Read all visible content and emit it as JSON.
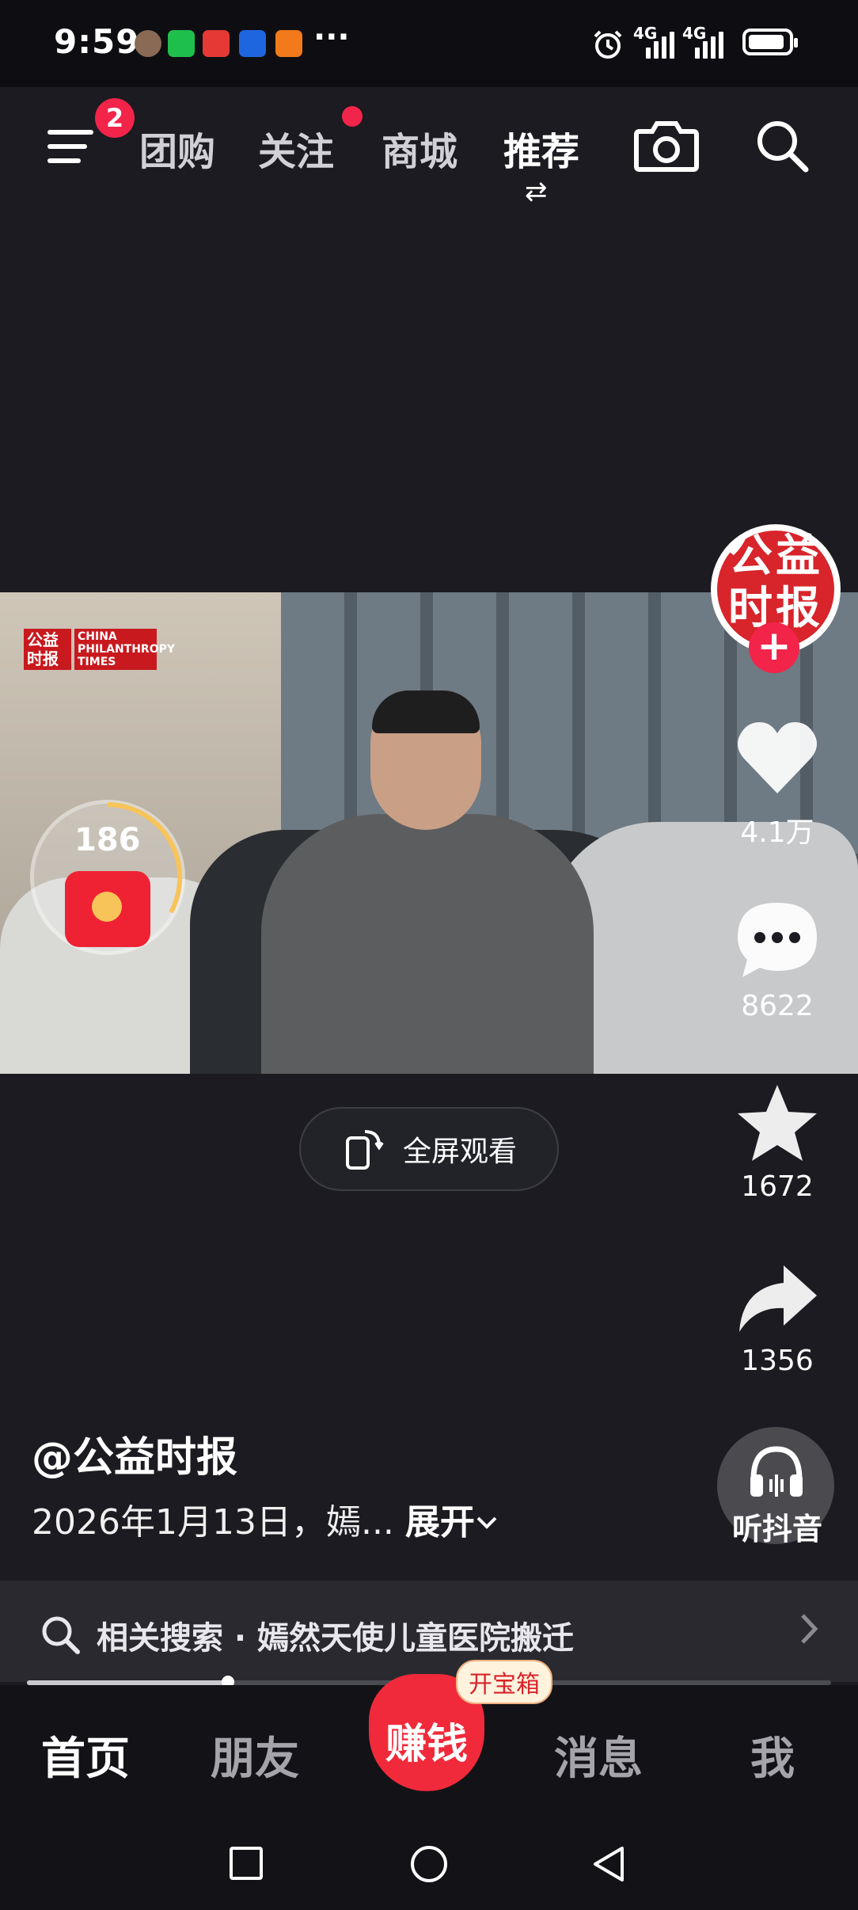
{
  "status_bar": {
    "time": "9:59",
    "overflow": "···",
    "signal1": "4G",
    "signal2": "4G",
    "icons": [
      "photo-avatar-icon",
      "wechat-icon",
      "red-app-icon",
      "blue-app-icon",
      "orange-app-icon",
      "alarm-icon",
      "battery-icon"
    ]
  },
  "top_nav": {
    "menu_badge": "2",
    "tabs": [
      {
        "label": "团购"
      },
      {
        "label": "关注"
      },
      {
        "label": "商城"
      },
      {
        "label": "推荐"
      }
    ],
    "active_tab": "推荐",
    "switch_glyph": "⇄"
  },
  "video": {
    "watermark_logo_cn": "公益时报",
    "watermark_logo_en": "CHINA PHILANTHROPY TIMES"
  },
  "red_packet": {
    "count": "186"
  },
  "right_rail": {
    "avatar_text": "公益时报",
    "follow_plus": "+",
    "likes": "4.1万",
    "comments": "8622",
    "favorites": "1672",
    "shares": "1356"
  },
  "fullscreen_button": {
    "label": "全屏观看"
  },
  "post": {
    "author": "@公益时报",
    "description": "2026年1月13日，嫣...",
    "expand_label": "展开"
  },
  "listen": {
    "label": "听抖音"
  },
  "related_search": {
    "text": "相关搜索 · 嫣然天使儿童医院搬迁"
  },
  "progress": {
    "fraction": 0.25
  },
  "bottom_tabs": {
    "home": "首页",
    "friends": "朋友",
    "earn": "赚钱",
    "treasure_badge": "开宝箱",
    "messages": "消息",
    "me": "我"
  },
  "colors": {
    "accent_red": "#f2244a",
    "background": "#1b1b21"
  }
}
